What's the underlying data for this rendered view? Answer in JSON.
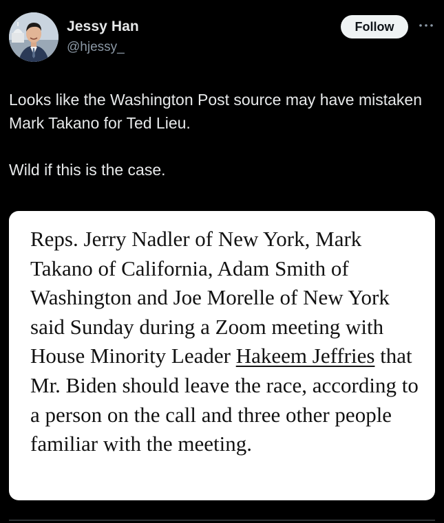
{
  "author": {
    "name": "Jessy Han",
    "handle": "@hjessy_"
  },
  "actions": {
    "follow_label": "Follow",
    "more_icon": "more-horizontal-icon"
  },
  "tweet": {
    "paragraphs": [
      "Looks like the Washington Post source may have mistaken Mark Takano for Ted Lieu.",
      "Wild if this is the case."
    ]
  },
  "quote": {
    "text_before_link": "Reps. Jerry Nadler of New York, Mark Takano of California, Adam Smith of Washington and Joe Morelle of New York said Sunday during a Zoom meeting with House Minority Leader ",
    "link_text": "Hakeem Jeffries",
    "text_after_link": " that Mr. Biden should leave the race, according to a person on the call and three other people familiar with the meeting."
  },
  "colors": {
    "background": "#000000",
    "primary_text": "#e7e9ea",
    "secondary_text": "#8b98a5",
    "follow_button_bg": "#eff3f4",
    "quote_card_bg": "#ffffff"
  }
}
